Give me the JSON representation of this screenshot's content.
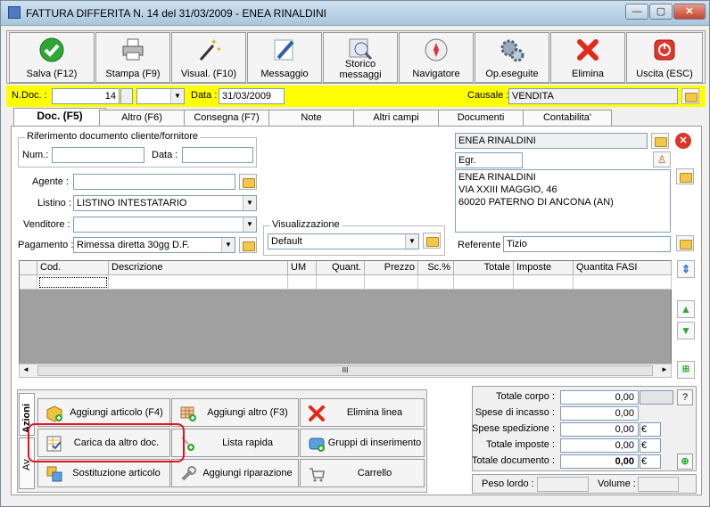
{
  "window": {
    "title": "FATTURA DIFFERITA N. 14  del 31/03/2009 - ENEA RINALDINI",
    "min": "—",
    "max": "▢",
    "close": "✕"
  },
  "toolbar": [
    {
      "label": "Salva (F12)",
      "icon": "check-icon"
    },
    {
      "label": "Stampa (F9)",
      "icon": "printer-icon"
    },
    {
      "label": "Visual. (F10)",
      "icon": "magic-wand-icon"
    },
    {
      "label": "Messaggio",
      "icon": "pen-icon"
    },
    {
      "label": "Storico\nmessaggi",
      "icon": "search-doc-icon"
    },
    {
      "label": "Navigatore",
      "icon": "compass-icon"
    },
    {
      "label": "Op.eseguite",
      "icon": "gears-icon"
    },
    {
      "label": "Elimina",
      "icon": "delete-x-icon"
    },
    {
      "label": "Uscita (ESC)",
      "icon": "exit-icon"
    }
  ],
  "header": {
    "ndoc_label": "N.Doc. :",
    "ndoc_value": "14",
    "ndoc_suffix": "",
    "data_label": "Data :",
    "data_value": "31/03/2009",
    "causale_label": "Causale :",
    "causale_value": "VENDITA"
  },
  "tabs": [
    "Doc. (F5)",
    "Altro (F6)",
    "Consegna (F7)",
    "Note",
    "Altri campi",
    "Documenti",
    "Contabilita'"
  ],
  "riferimento": {
    "title": "Riferimento documento cliente/fornitore",
    "num_label": "Num.:",
    "num_value": "",
    "data_label": "Data :",
    "data_value": ""
  },
  "fields": {
    "agente_label": "Agente :",
    "agente_value": "",
    "listino_label": "Listino :",
    "listino_value": "LISTINO INTESTATARIO",
    "venditore_label": "Venditore :",
    "venditore_value": "",
    "pagamento_label": "Pagamento :",
    "pagamento_value": "Rimessa diretta 30gg D.F.",
    "visual_title": "Visualizzazione",
    "visual_value": "Default"
  },
  "customer": {
    "name": "ENEA RINALDINI",
    "salutation": "Egr.",
    "address_lines": [
      "ENEA RINALDINI",
      "VIA XXIII MAGGIO, 46",
      "60020 PATERNO DI ANCONA (AN)"
    ],
    "referente_label": "Referente",
    "referente_value": "Tizio"
  },
  "grid": {
    "columns": [
      "Cod.",
      "Descrizione",
      "UM",
      "Quant.",
      "Prezzo",
      "Sc.%",
      "Totale",
      "Imposte",
      "Quantita FASI"
    ],
    "scroll_mark": "III"
  },
  "actions": {
    "vtab1": "Azioni",
    "vtab2": "Av",
    "buttons": [
      {
        "label": "Aggiungi articolo (F4)",
        "icon": "add-box-icon"
      },
      {
        "label": "Aggiungi altro (F3)",
        "icon": "add-grid-icon"
      },
      {
        "label": "Elimina linea",
        "icon": "delete-x-icon"
      },
      {
        "label": "Carica da altro doc.",
        "icon": "load-doc-icon"
      },
      {
        "label": "Lista rapida",
        "icon": "quick-list-icon"
      },
      {
        "label": "Gruppi di inserimento",
        "icon": "group-insert-icon"
      },
      {
        "label": "Sostituzione articolo",
        "icon": "replace-icon"
      },
      {
        "label": "Aggiungi riparazione",
        "icon": "wrench-icon"
      },
      {
        "label": "Carrello",
        "icon": "cart-icon"
      }
    ]
  },
  "totals": {
    "rows": [
      {
        "label": "Totale corpo :",
        "value": "0,00",
        "cur": ""
      },
      {
        "label": "Spese di incasso :",
        "value": "0,00",
        "cur": ""
      },
      {
        "label": "Spese spedizione :",
        "value": "0,00",
        "cur": "€"
      },
      {
        "label": "Totale imposte :",
        "value": "0,00",
        "cur": "€"
      },
      {
        "label": "Totale documento :",
        "value": "0,00",
        "cur": "€"
      }
    ],
    "help": "?"
  },
  "weights": {
    "peso_label": "Peso lordo :",
    "peso_value": "",
    "volume_label": "Volume :",
    "volume_value": ""
  },
  "colors": {
    "yellow_band": "#ffff00",
    "highlight": "#e0141e",
    "accent_green": "#2ea832"
  }
}
